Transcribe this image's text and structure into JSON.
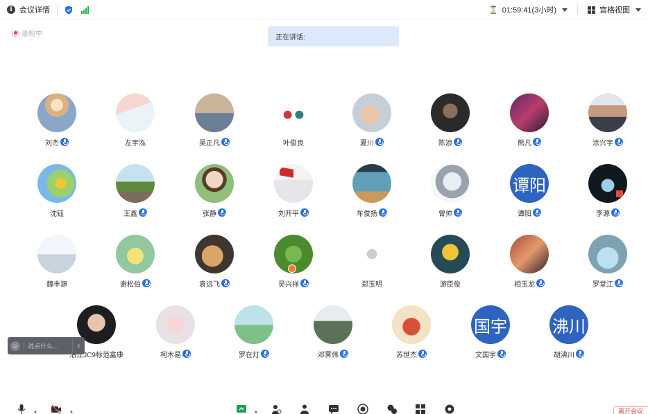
{
  "topbar": {
    "meeting_info_label": "会议详情",
    "timer": "01:59:41(3小时)",
    "view_label": "宫格视图"
  },
  "recording_label": "录制中",
  "speaking_label": "正在讲话:",
  "participants": [
    {
      "name": "刘杰",
      "mic": "on"
    },
    {
      "name": "左宇泓",
      "mic": "none"
    },
    {
      "name": "吴正凡",
      "mic": "on"
    },
    {
      "name": "叶俊良",
      "mic": "none"
    },
    {
      "name": "夏川",
      "mic": "on"
    },
    {
      "name": "陈浪",
      "mic": "on"
    },
    {
      "name": "熊凡",
      "mic": "on"
    },
    {
      "name": "涂兴宇",
      "mic": "on"
    },
    {
      "name": "沈钰",
      "mic": "none"
    },
    {
      "name": "王鑫",
      "mic": "on"
    },
    {
      "name": "张静",
      "mic": "on"
    },
    {
      "name": "刘开平",
      "mic": "on"
    },
    {
      "name": "车俊扬",
      "mic": "on"
    },
    {
      "name": "曾帅",
      "mic": "on"
    },
    {
      "name": "谭阳",
      "mic": "on",
      "avatar_text": "谭阳"
    },
    {
      "name": "李源",
      "mic": "on"
    },
    {
      "name": "魏丰源",
      "mic": "none"
    },
    {
      "name": "谢松伯",
      "mic": "on"
    },
    {
      "name": "袁远飞",
      "mic": "on"
    },
    {
      "name": "吴兴祥",
      "mic": "on",
      "host": true
    },
    {
      "name": "郑玉明",
      "mic": "none"
    },
    {
      "name": "游臣俊",
      "mic": "none"
    },
    {
      "name": "相玉龙",
      "mic": "on"
    },
    {
      "name": "罗堂江",
      "mic": "on"
    },
    {
      "name": "沿江JC9标范富康",
      "mic": "none"
    },
    {
      "name": "柯木易",
      "mic": "on"
    },
    {
      "name": "罗在灯",
      "mic": "on"
    },
    {
      "name": "邓霁伟",
      "mic": "on"
    },
    {
      "name": "苏世杰",
      "mic": "on"
    },
    {
      "name": "文国宇",
      "mic": "on",
      "avatar_text": "国宇"
    },
    {
      "name": "胡沸川",
      "mic": "on",
      "avatar_text": "沸川"
    }
  ],
  "chat": {
    "placeholder": "说点什么...",
    "emoji_icon": "smiley-icon",
    "toggle_icon": "chevron-left-icon"
  },
  "toolbar": {
    "leave_label": "离开会议"
  },
  "colors": {
    "accent": "#2b6fe0",
    "speaking_bg": "#dbe9fb",
    "text_avatar_bg": "#2e64c0",
    "signal": "#22b14c",
    "record": "#e64545"
  }
}
